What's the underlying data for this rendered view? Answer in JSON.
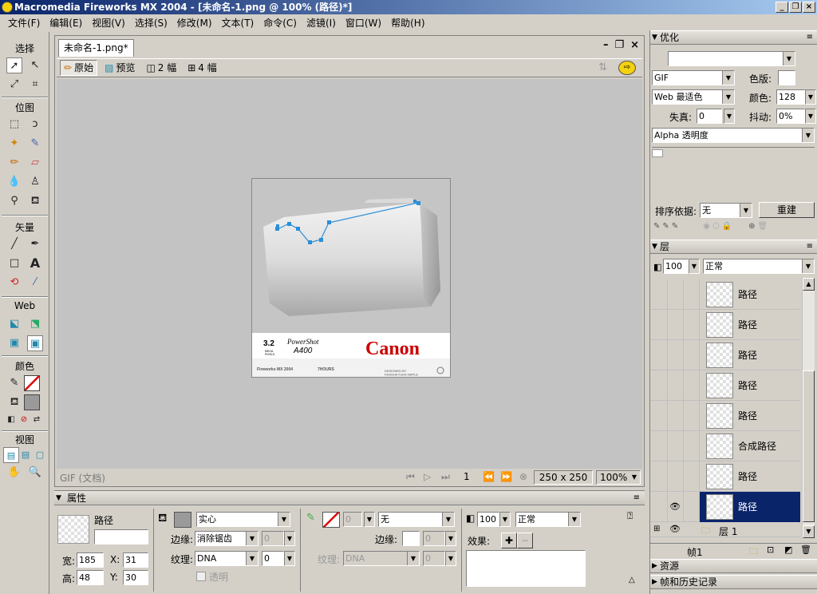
{
  "window": {
    "title": "Macromedia Fireworks MX 2004 - [未命名-1.png @ 100% (路径)*]",
    "min": "_",
    "restore": "❐",
    "close": "×"
  },
  "menu": [
    "文件(F)",
    "编辑(E)",
    "视图(V)",
    "选择(S)",
    "修改(M)",
    "文本(T)",
    "命令(C)",
    "滤镜(I)",
    "窗口(W)",
    "帮助(H)"
  ],
  "tools": {
    "select": "选择",
    "bitmap": "位图",
    "vector": "矢量",
    "web": "Web",
    "colors": "颜色",
    "view": "视图"
  },
  "document": {
    "tab": "未命名-1.png*",
    "views": [
      "原始",
      "预览",
      "2 幅",
      "4 幅"
    ],
    "format": "GIF (文档)",
    "frame": "1",
    "size": "250 x 250",
    "zoom": "100%"
  },
  "artwork": {
    "megapixels": "3.2",
    "mega_label": "MEGA\nPIXELS",
    "product": "PowerShot",
    "model": "A400",
    "brand": "Canon",
    "app": "Fireworks MX 2004",
    "hours": "7HOURS",
    "credit": "DESIGNED BY\nFENGHEYUER.NAPLE"
  },
  "properties": {
    "title": "属性",
    "object": "路径",
    "width_label": "宽:",
    "width": "185",
    "height_label": "高:",
    "height": "48",
    "x_label": "X:",
    "x": "31",
    "y_label": "Y:",
    "y": "30",
    "fill_type": "实心",
    "edge_label": "边缘:",
    "edge": "消除锯齿",
    "edge_val": "0",
    "texture_label": "纹理:",
    "texture": "DNA",
    "texture_val": "0",
    "transparent": "透明",
    "stroke_type": "无",
    "stroke_size": "0",
    "stroke_edge_label": "边缘:",
    "stroke_edge_val": "0",
    "stroke_texture_label": "纹理:",
    "stroke_texture": "DNA",
    "stroke_texture_val": "0",
    "opacity": "100",
    "blend": "正常",
    "effects_label": "效果:"
  },
  "optimize": {
    "title": "优化",
    "preset": "",
    "format": "GIF",
    "palette_label": "色版:",
    "palette": "Web 最适色",
    "colors_label": "颜色:",
    "colors": "128",
    "loss_label": "失真:",
    "loss": "0",
    "dither_label": "抖动:",
    "dither": "0%",
    "transparency": "Alpha 透明度",
    "sort_label": "排序依据:",
    "sort": "无",
    "rebuild": "重建"
  },
  "layers": {
    "title": "层",
    "opacity": "100",
    "blend": "正常",
    "items": [
      "路径",
      "路径",
      "路径",
      "路径",
      "路径",
      "合成路径",
      "路径",
      "路径"
    ],
    "group": "层 1",
    "frame": "帧1"
  },
  "assets": {
    "title": "资源"
  },
  "history": {
    "title": "帧和历史记录"
  }
}
